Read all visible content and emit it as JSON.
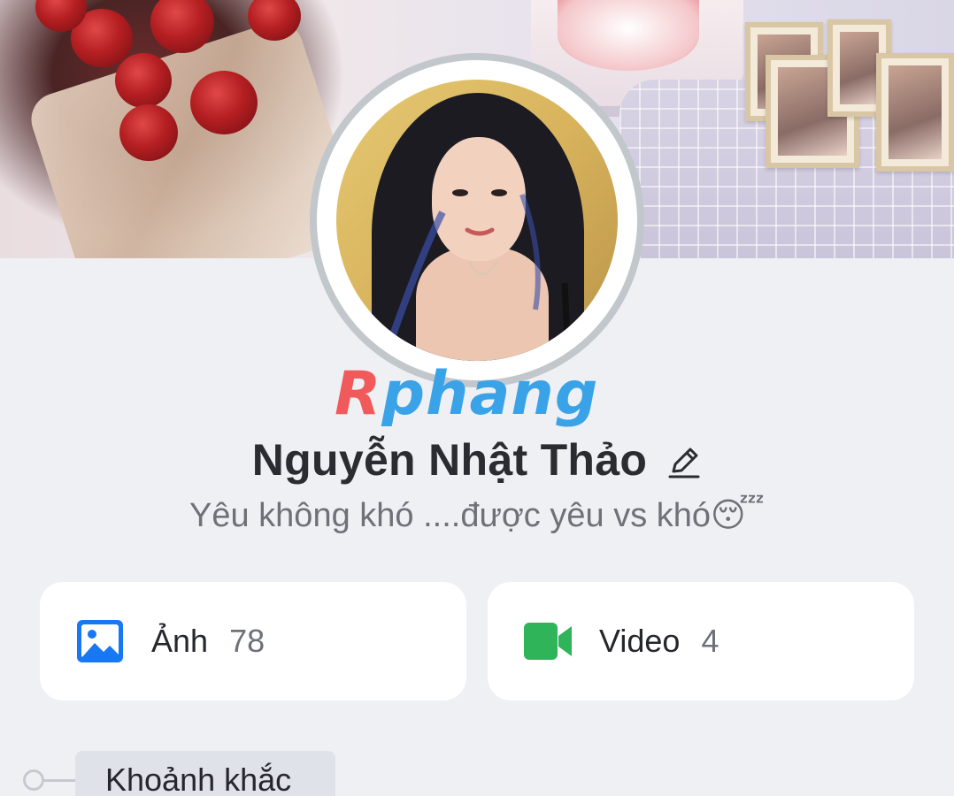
{
  "profile": {
    "name": "Nguyễn Nhật Thảo",
    "bio": "Yêu không khó ....được yêu vs khó😴"
  },
  "watermark": {
    "first_letter": "R",
    "rest": "phang"
  },
  "stats": {
    "photos": {
      "label": "Ảnh",
      "count": "78",
      "icon": "image-icon",
      "color": "#1877f2"
    },
    "videos": {
      "label": "Video",
      "count": "4",
      "icon": "video-camera-icon",
      "color": "#2fb45a"
    }
  },
  "timeline": {
    "section_label": "Khoảnh khắc"
  },
  "colors": {
    "background": "#eef0f4",
    "card": "#ffffff",
    "text_primary": "#2a2c31",
    "text_secondary": "#6e7178",
    "watermark_red": "#f05a5a",
    "watermark_blue": "#3aa3e8"
  }
}
